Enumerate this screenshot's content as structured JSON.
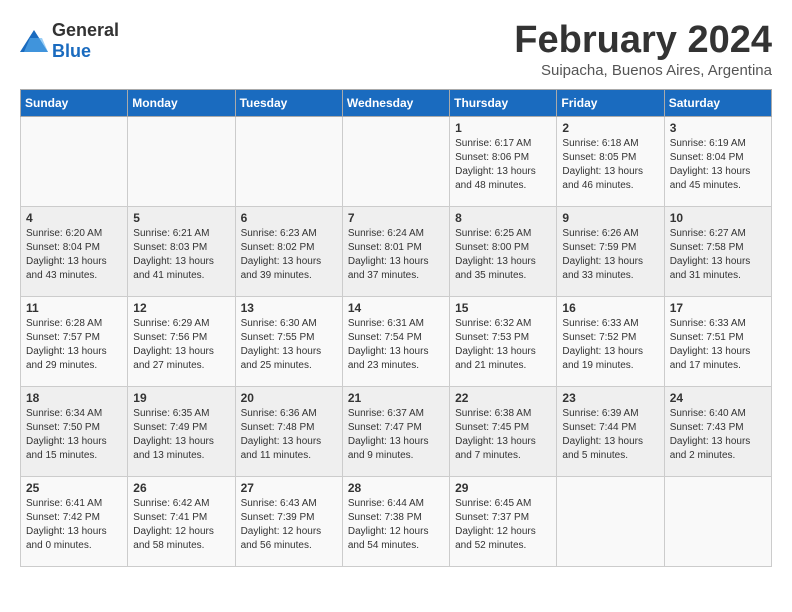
{
  "logo": {
    "general": "General",
    "blue": "Blue"
  },
  "header": {
    "month": "February 2024",
    "location": "Suipacha, Buenos Aires, Argentina"
  },
  "weekdays": [
    "Sunday",
    "Monday",
    "Tuesday",
    "Wednesday",
    "Thursday",
    "Friday",
    "Saturday"
  ],
  "weeks": [
    [
      {
        "day": "",
        "info": ""
      },
      {
        "day": "",
        "info": ""
      },
      {
        "day": "",
        "info": ""
      },
      {
        "day": "",
        "info": ""
      },
      {
        "day": "1",
        "info": "Sunrise: 6:17 AM\nSunset: 8:06 PM\nDaylight: 13 hours\nand 48 minutes."
      },
      {
        "day": "2",
        "info": "Sunrise: 6:18 AM\nSunset: 8:05 PM\nDaylight: 13 hours\nand 46 minutes."
      },
      {
        "day": "3",
        "info": "Sunrise: 6:19 AM\nSunset: 8:04 PM\nDaylight: 13 hours\nand 45 minutes."
      }
    ],
    [
      {
        "day": "4",
        "info": "Sunrise: 6:20 AM\nSunset: 8:04 PM\nDaylight: 13 hours\nand 43 minutes."
      },
      {
        "day": "5",
        "info": "Sunrise: 6:21 AM\nSunset: 8:03 PM\nDaylight: 13 hours\nand 41 minutes."
      },
      {
        "day": "6",
        "info": "Sunrise: 6:23 AM\nSunset: 8:02 PM\nDaylight: 13 hours\nand 39 minutes."
      },
      {
        "day": "7",
        "info": "Sunrise: 6:24 AM\nSunset: 8:01 PM\nDaylight: 13 hours\nand 37 minutes."
      },
      {
        "day": "8",
        "info": "Sunrise: 6:25 AM\nSunset: 8:00 PM\nDaylight: 13 hours\nand 35 minutes."
      },
      {
        "day": "9",
        "info": "Sunrise: 6:26 AM\nSunset: 7:59 PM\nDaylight: 13 hours\nand 33 minutes."
      },
      {
        "day": "10",
        "info": "Sunrise: 6:27 AM\nSunset: 7:58 PM\nDaylight: 13 hours\nand 31 minutes."
      }
    ],
    [
      {
        "day": "11",
        "info": "Sunrise: 6:28 AM\nSunset: 7:57 PM\nDaylight: 13 hours\nand 29 minutes."
      },
      {
        "day": "12",
        "info": "Sunrise: 6:29 AM\nSunset: 7:56 PM\nDaylight: 13 hours\nand 27 minutes."
      },
      {
        "day": "13",
        "info": "Sunrise: 6:30 AM\nSunset: 7:55 PM\nDaylight: 13 hours\nand 25 minutes."
      },
      {
        "day": "14",
        "info": "Sunrise: 6:31 AM\nSunset: 7:54 PM\nDaylight: 13 hours\nand 23 minutes."
      },
      {
        "day": "15",
        "info": "Sunrise: 6:32 AM\nSunset: 7:53 PM\nDaylight: 13 hours\nand 21 minutes."
      },
      {
        "day": "16",
        "info": "Sunrise: 6:33 AM\nSunset: 7:52 PM\nDaylight: 13 hours\nand 19 minutes."
      },
      {
        "day": "17",
        "info": "Sunrise: 6:33 AM\nSunset: 7:51 PM\nDaylight: 13 hours\nand 17 minutes."
      }
    ],
    [
      {
        "day": "18",
        "info": "Sunrise: 6:34 AM\nSunset: 7:50 PM\nDaylight: 13 hours\nand 15 minutes."
      },
      {
        "day": "19",
        "info": "Sunrise: 6:35 AM\nSunset: 7:49 PM\nDaylight: 13 hours\nand 13 minutes."
      },
      {
        "day": "20",
        "info": "Sunrise: 6:36 AM\nSunset: 7:48 PM\nDaylight: 13 hours\nand 11 minutes."
      },
      {
        "day": "21",
        "info": "Sunrise: 6:37 AM\nSunset: 7:47 PM\nDaylight: 13 hours\nand 9 minutes."
      },
      {
        "day": "22",
        "info": "Sunrise: 6:38 AM\nSunset: 7:45 PM\nDaylight: 13 hours\nand 7 minutes."
      },
      {
        "day": "23",
        "info": "Sunrise: 6:39 AM\nSunset: 7:44 PM\nDaylight: 13 hours\nand 5 minutes."
      },
      {
        "day": "24",
        "info": "Sunrise: 6:40 AM\nSunset: 7:43 PM\nDaylight: 13 hours\nand 2 minutes."
      }
    ],
    [
      {
        "day": "25",
        "info": "Sunrise: 6:41 AM\nSunset: 7:42 PM\nDaylight: 13 hours\nand 0 minutes."
      },
      {
        "day": "26",
        "info": "Sunrise: 6:42 AM\nSunset: 7:41 PM\nDaylight: 12 hours\nand 58 minutes."
      },
      {
        "day": "27",
        "info": "Sunrise: 6:43 AM\nSunset: 7:39 PM\nDaylight: 12 hours\nand 56 minutes."
      },
      {
        "day": "28",
        "info": "Sunrise: 6:44 AM\nSunset: 7:38 PM\nDaylight: 12 hours\nand 54 minutes."
      },
      {
        "day": "29",
        "info": "Sunrise: 6:45 AM\nSunset: 7:37 PM\nDaylight: 12 hours\nand 52 minutes."
      },
      {
        "day": "",
        "info": ""
      },
      {
        "day": "",
        "info": ""
      }
    ]
  ]
}
